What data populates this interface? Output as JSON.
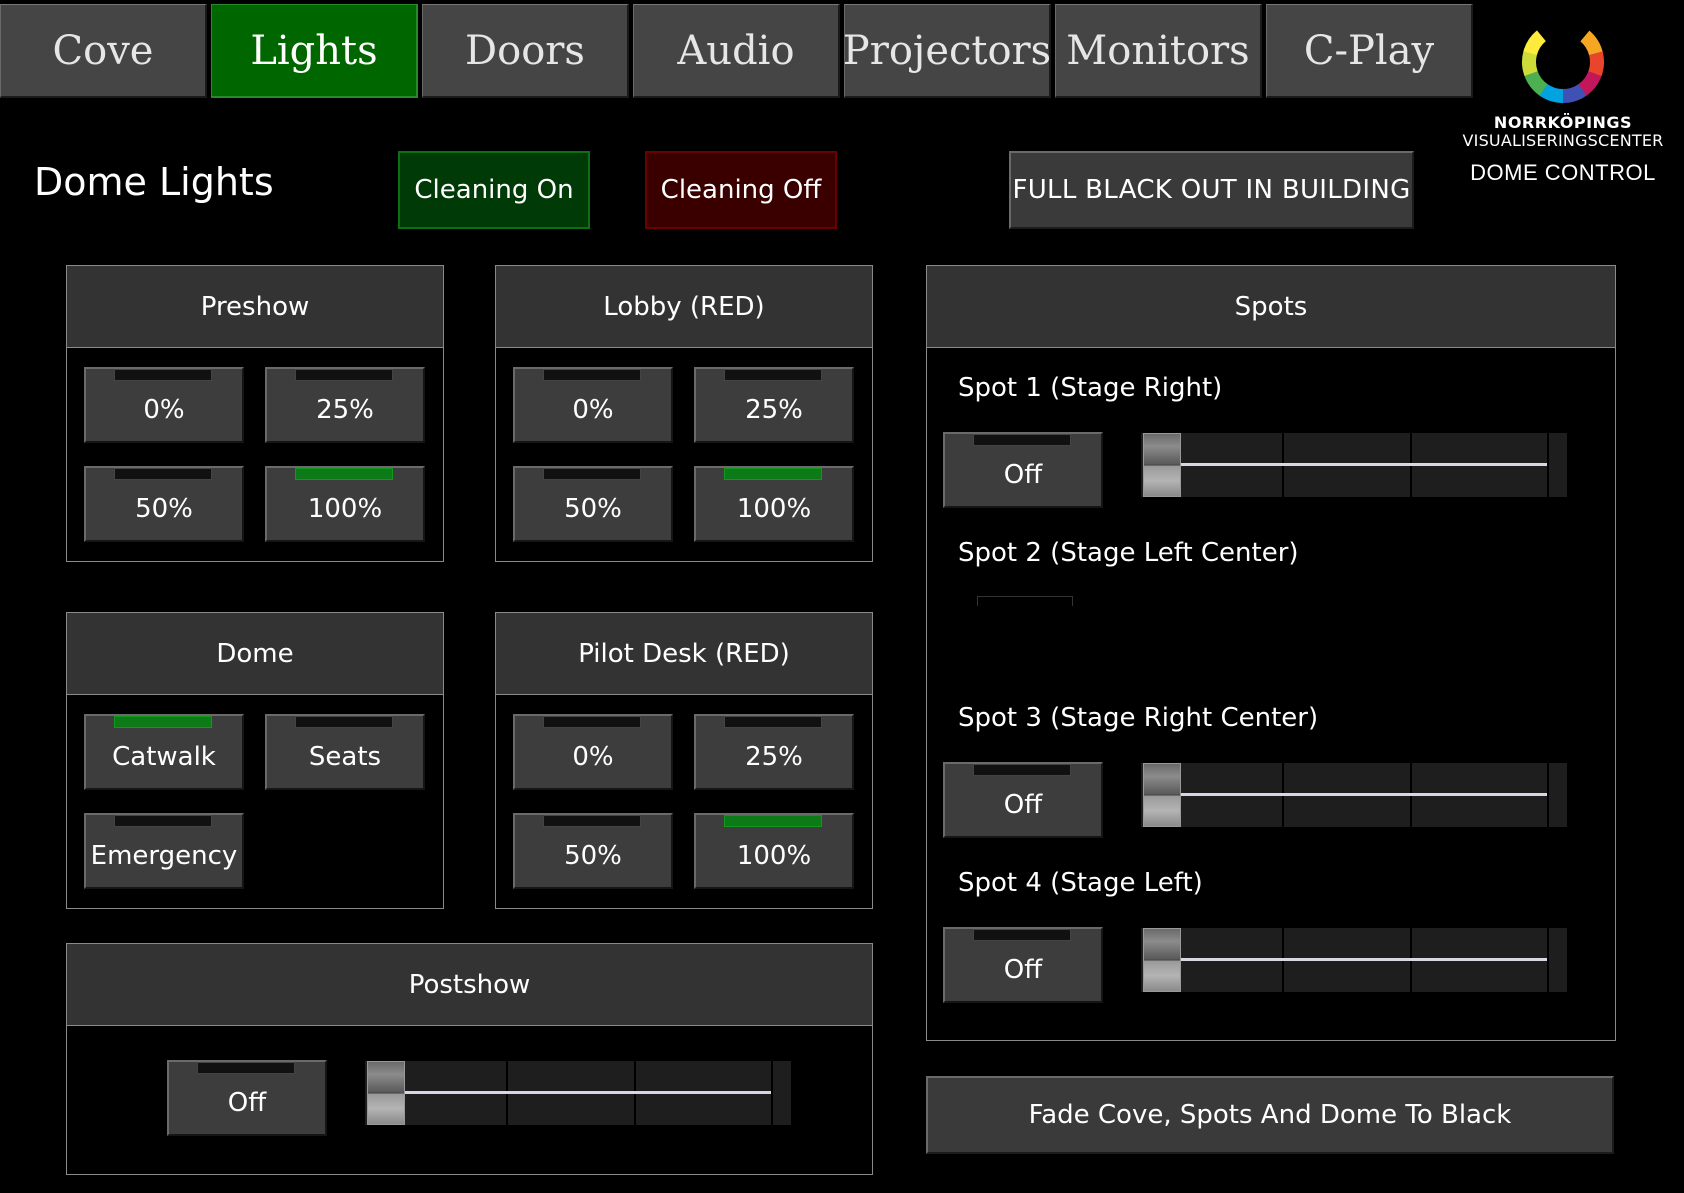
{
  "nav": {
    "tabs": [
      {
        "label": "Cove",
        "active": false
      },
      {
        "label": "Lights",
        "active": true
      },
      {
        "label": "Doors",
        "active": false
      },
      {
        "label": "Audio",
        "active": false
      },
      {
        "label": "Projectors",
        "active": false
      },
      {
        "label": "Monitors",
        "active": false
      },
      {
        "label": "C-Play",
        "active": false
      }
    ]
  },
  "logo": {
    "line1": "NORRKÖPINGS",
    "line2": "VISUALISERINGSCENTER",
    "subtitle": "DOME CONTROL",
    "ring_colors": [
      "#f5a623",
      "#e8452c",
      "#c2185b",
      "#3f51b5",
      "#00a3e0",
      "#4caf50",
      "#cddc39",
      "#ffeb3b"
    ]
  },
  "page": {
    "title": "Dome Lights",
    "cleaning_on": "Cleaning On",
    "cleaning_off": "Cleaning Off",
    "blackout": "FULL BLACK OUT IN BUILDING"
  },
  "preshow": {
    "title": "Preshow",
    "buttons": [
      {
        "label": "0%",
        "on": false
      },
      {
        "label": "25%",
        "on": false
      },
      {
        "label": "50%",
        "on": false
      },
      {
        "label": "100%",
        "on": true
      }
    ]
  },
  "lobby": {
    "title": "Lobby (RED)",
    "buttons": [
      {
        "label": "0%",
        "on": false
      },
      {
        "label": "25%",
        "on": false
      },
      {
        "label": "50%",
        "on": false
      },
      {
        "label": "100%",
        "on": true
      }
    ]
  },
  "dome": {
    "title": "Dome",
    "buttons": [
      {
        "label": "Catwalk",
        "on": true
      },
      {
        "label": "Seats",
        "on": false
      },
      {
        "label": "Emergency",
        "on": false
      }
    ]
  },
  "pilot": {
    "title": "Pilot Desk (RED)",
    "buttons": [
      {
        "label": "0%",
        "on": false
      },
      {
        "label": "25%",
        "on": false
      },
      {
        "label": "50%",
        "on": false
      },
      {
        "label": "100%",
        "on": true
      }
    ]
  },
  "postshow": {
    "title": "Postshow",
    "button": "Off",
    "level": 0
  },
  "spots": {
    "title": "Spots",
    "items": [
      {
        "label": "Spot 1 (Stage Right)",
        "button": "Off",
        "level": 0
      },
      {
        "label": "Spot 2 (Stage Left Center)"
      },
      {
        "label": "Spot 3 (Stage Right Center)",
        "button": "Off",
        "level": 0
      },
      {
        "label": "Spot 4 (Stage Left)",
        "button": "Off",
        "level": 0
      }
    ]
  },
  "fade": {
    "label": "Fade Cove, Spots And Dome To Black"
  }
}
